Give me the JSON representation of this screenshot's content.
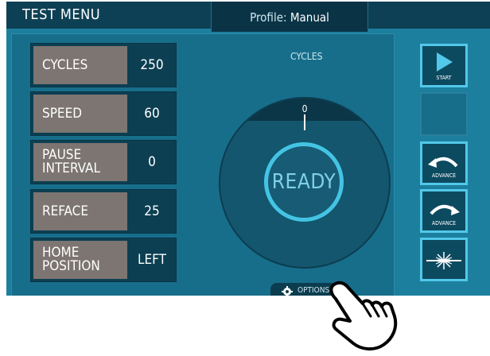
{
  "header": {
    "title": "TEST MENU",
    "profile_label": "Profile:",
    "profile_value": "Manual"
  },
  "params": [
    {
      "label": "CYCLES",
      "value": "250"
    },
    {
      "label": "SPEED",
      "value": "60"
    },
    {
      "label": "PAUSE\nINTERVAL",
      "value": "0"
    },
    {
      "label": "REFACE",
      "value": "25"
    },
    {
      "label": "HOME\nPOSITION",
      "value": "LEFT"
    }
  ],
  "dial": {
    "title": "CYCLES",
    "count": "0",
    "status": "READY"
  },
  "side_buttons": [
    {
      "icon": "play-icon",
      "caption": "START"
    },
    {
      "icon": "blank",
      "caption": ""
    },
    {
      "icon": "rotate-left-icon",
      "caption": "ADVANCE"
    },
    {
      "icon": "rotate-right-icon",
      "caption": "ADVANCE"
    },
    {
      "icon": "laser-icon",
      "caption": ""
    }
  ],
  "options": {
    "label": "OPTIONS",
    "icon": "gear-icon"
  },
  "colors": {
    "screen": "#1d7f9e",
    "accent": "#44c4e4",
    "header": "#0d4054",
    "label_bg": "#7c7571"
  }
}
